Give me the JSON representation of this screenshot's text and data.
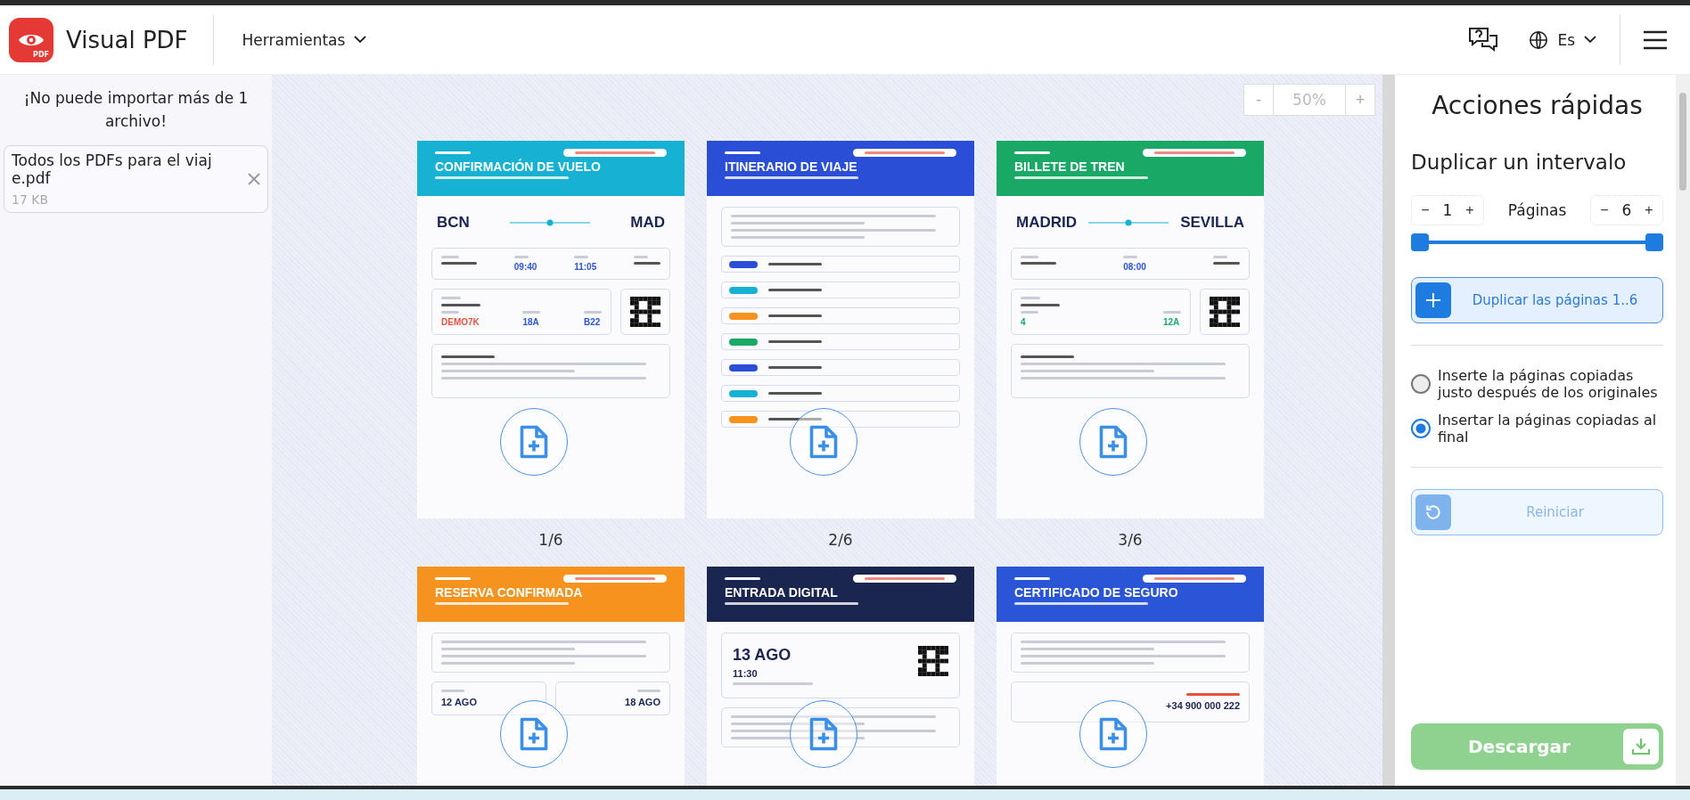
{
  "header": {
    "brand": "Visual PDF",
    "logo_badge": "PDF",
    "tools_menu": "Herramientas",
    "language": "Es"
  },
  "sidebar": {
    "message": "¡No puede importar más de 1 archivo!",
    "file": {
      "name": "Todos los PDFs para el viaj e.pdf",
      "size": "17 KB"
    }
  },
  "viewer": {
    "zoom": "50%",
    "minus": "-",
    "plus": "+",
    "pages": [
      {
        "label": "1/6",
        "color": "#17b2d3",
        "title": "CONFIRMACIÓN DE VUELO",
        "blocks": [
          {
            "kind": "route",
            "from": "BCN",
            "to": "MAD"
          },
          {
            "kind": "values",
            "items": [
              {
                "value": "09:40",
                "color": "#2a55d6"
              },
              {
                "value": "11:05",
                "color": "#2a55d6"
              }
            ]
          },
          {
            "kind": "qrvalues",
            "items": [
              {
                "value": "DEMO7K",
                "color": "#e5533d"
              },
              {
                "value": "18A",
                "color": "#2a55d6"
              },
              {
                "value": "B22",
                "color": "#2a55d6"
              }
            ]
          },
          {
            "kind": "note"
          }
        ]
      },
      {
        "label": "2/6",
        "color": "#2a4fd6",
        "title": "ITINERARIO DE VIAJE",
        "blocks": [
          {
            "kind": "lines"
          },
          {
            "kind": "timeline",
            "items": [
              {
                "color": "#2a4fd6"
              },
              {
                "color": "#17b2d3"
              },
              {
                "color": "#f5931e"
              },
              {
                "color": "#1aa866"
              },
              {
                "color": "#2a4fd6"
              },
              {
                "color": "#17b2d3"
              },
              {
                "color": "#f5931e"
              }
            ]
          }
        ]
      },
      {
        "label": "3/6",
        "color": "#1aa866",
        "title": "BILLETE DE TREN",
        "blocks": [
          {
            "kind": "route",
            "from": "MADRID",
            "to": "SEVILLA"
          },
          {
            "kind": "values",
            "items": [
              {
                "value": "08:00",
                "color": "#2a55d6"
              }
            ]
          },
          {
            "kind": "qrvalues",
            "items": [
              {
                "value": "4",
                "color": "#1aa866"
              },
              {
                "value": "12A",
                "color": "#1aa866"
              }
            ]
          },
          {
            "kind": "note"
          }
        ]
      },
      {
        "color": "#f5931e",
        "title": "RESERVA CONFIRMADA",
        "blocks": [
          {
            "kind": "lines"
          },
          {
            "kind": "dates",
            "items": [
              {
                "value": "12 AGO"
              },
              {
                "value": "18 AGO"
              }
            ]
          }
        ]
      },
      {
        "color": "#1a2550",
        "title": "ENTRADA DIGITAL",
        "blocks": [
          {
            "kind": "ticket",
            "date": "13 AGO",
            "time": "11:30"
          },
          {
            "kind": "lines"
          }
        ]
      },
      {
        "color": "#2a55d6",
        "title": "CERTIFICADO DE SEGURO",
        "blocks": [
          {
            "kind": "lines"
          },
          {
            "kind": "phone",
            "value": "+34 900 000 222"
          }
        ]
      }
    ]
  },
  "panel": {
    "title": "Acciones rápidas",
    "section": "Duplicar un intervalo",
    "minus": "−",
    "plus": "+",
    "from": "1",
    "to": "6",
    "range_label": "Páginas",
    "thumbs": [
      {
        "level": 0
      },
      {
        "level": 1
      }
    ],
    "duplicate_button": "Duplicar las páginas 1..6",
    "options": [
      {
        "label": "Inserte la páginas copiadas justo después de los originales",
        "selected": false
      },
      {
        "label": "Insertar la páginas copiadas al final",
        "selected": true
      }
    ],
    "reset_button": {
      "label": "Reiniciar",
      "disabled": true
    },
    "download_button": {
      "label": "Descargar",
      "disabled": true
    }
  }
}
